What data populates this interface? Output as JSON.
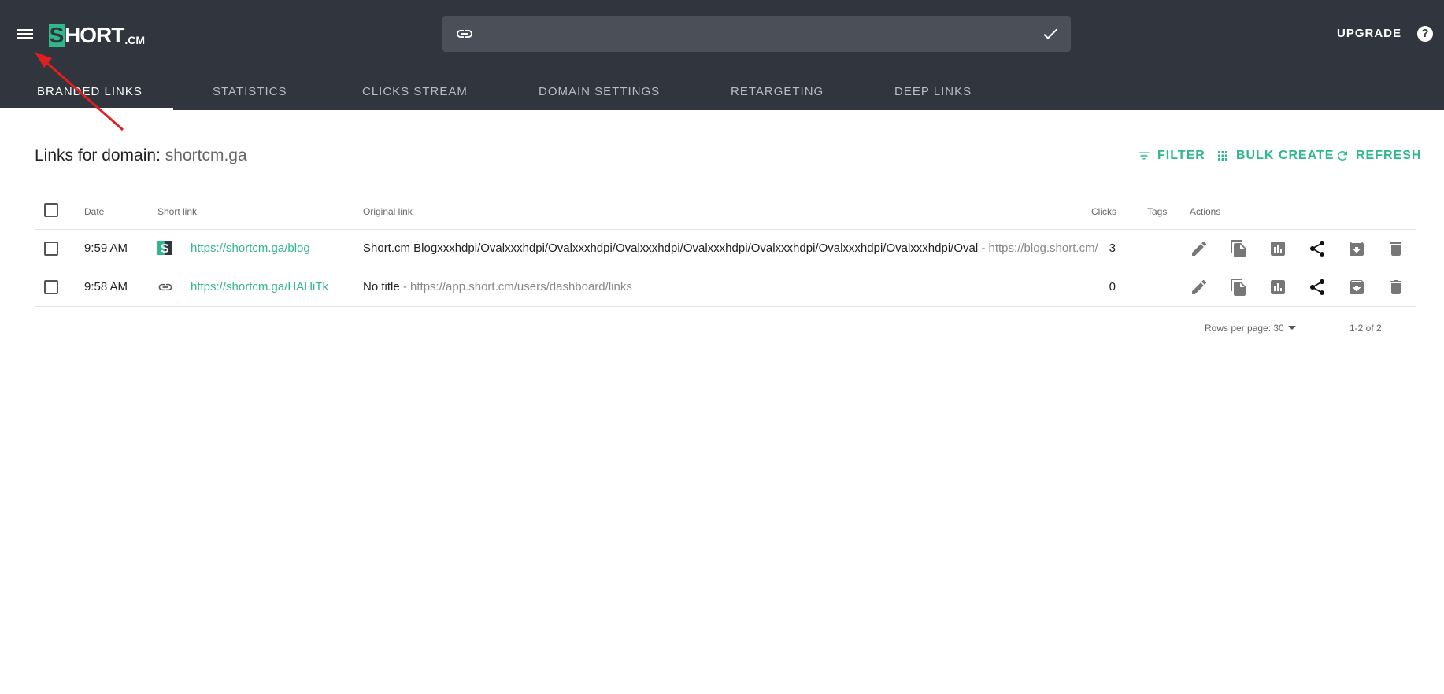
{
  "header": {
    "logo_mark": "S",
    "logo_word": "HORT",
    "logo_tld": ".CM",
    "search_placeholder": "",
    "upgrade_label": "UPGRADE",
    "help_label": "?"
  },
  "tabs": [
    {
      "label": "BRANDED LINKS",
      "active": true
    },
    {
      "label": "STATISTICS",
      "active": false
    },
    {
      "label": "CLICKS STREAM",
      "active": false
    },
    {
      "label": "DOMAIN SETTINGS",
      "active": false
    },
    {
      "label": "RETARGETING",
      "active": false
    },
    {
      "label": "DEEP LINKS",
      "active": false
    }
  ],
  "page": {
    "title_prefix": "Links for domain:",
    "domain": "shortcm.ga",
    "actions": {
      "filter": "FILTER",
      "bulk_create": "BULK CREATE",
      "refresh": "REFRESH"
    }
  },
  "table": {
    "columns": {
      "date": "Date",
      "short_link": "Short link",
      "original_link": "Original link",
      "clicks": "Clicks",
      "tags": "Tags",
      "actions": "Actions"
    },
    "rows": [
      {
        "date": "9:59 AM",
        "favicon": "shortcm-favicon",
        "short_link": "https://shortcm.ga/blog",
        "original_title": "Short.cm Blogxxxhdpi/Ovalxxxhdpi/Ovalxxxhdpi/Ovalxxxhdpi/Ovalxxxhdpi/Ovalxxxhdpi/Ovalxxxhdpi/Ovalxxxhdpi/Oval",
        "original_url": " - https://blog.short.cm/",
        "clicks": "3",
        "tags": ""
      },
      {
        "date": "9:58 AM",
        "favicon": "link-icon",
        "short_link": "https://shortcm.ga/HAHiTk",
        "original_title": "No title",
        "original_url": " - https://app.short.cm/users/dashboard/links",
        "clicks": "0",
        "tags": ""
      }
    ]
  },
  "footer": {
    "rows_per_page": "Rows per page: 30",
    "range": "1-2 of 2"
  },
  "colors": {
    "header_bg": "#30353e",
    "accent": "#2fb88a",
    "annotation_arrow": "#e02020"
  }
}
